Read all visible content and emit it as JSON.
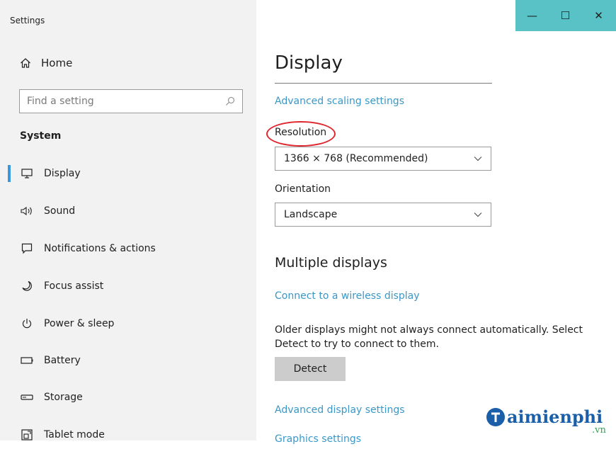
{
  "window": {
    "title": "Settings",
    "controls": {
      "minimize": "—",
      "maximize": "☐",
      "close": "✕"
    },
    "titlebar_color": "#59c2c7"
  },
  "sidebar": {
    "home_label": "Home",
    "search_placeholder": "Find a setting",
    "section_heading": "System",
    "items": [
      {
        "label": "Display",
        "icon": "display-icon",
        "active": true
      },
      {
        "label": "Sound",
        "icon": "sound-icon"
      },
      {
        "label": "Notifications & actions",
        "icon": "notifications-icon"
      },
      {
        "label": "Focus assist",
        "icon": "focus-assist-icon"
      },
      {
        "label": "Power & sleep",
        "icon": "power-icon"
      },
      {
        "label": "Battery",
        "icon": "battery-icon"
      },
      {
        "label": "Storage",
        "icon": "storage-icon"
      },
      {
        "label": "Tablet mode",
        "icon": "tablet-mode-icon"
      }
    ],
    "accent": "#3a96dd"
  },
  "main": {
    "heading": "Display",
    "advanced_scaling_link": "Advanced scaling settings",
    "resolution_label": "Resolution",
    "resolution_value": "1366 × 768 (Recommended)",
    "orientation_label": "Orientation",
    "orientation_value": "Landscape",
    "multiple_displays_heading": "Multiple displays",
    "wireless_link": "Connect to a wireless display",
    "description": "Older displays might not always connect automatically. Select Detect to try to connect to them.",
    "detect_button": "Detect",
    "advanced_display_link": "Advanced display settings",
    "graphics_link": "Graphics settings",
    "link_color": "#3a98c8",
    "highlight_color": "#e0262d"
  },
  "watermark": {
    "brand": "aimienphi",
    "suffix": ".vn"
  }
}
